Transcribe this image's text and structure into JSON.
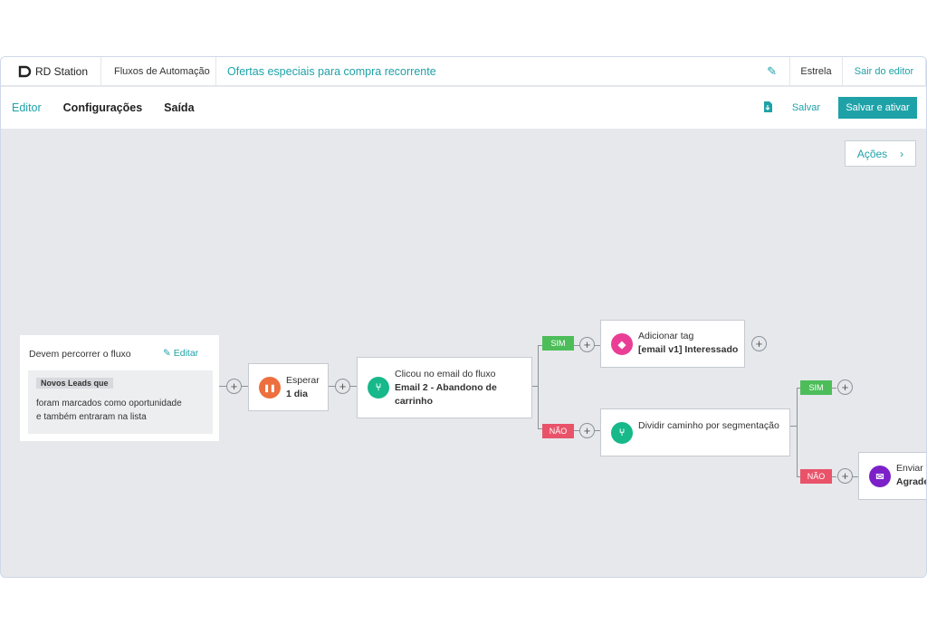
{
  "topbar": {
    "logo": "RD Station",
    "breadcrumb": "Fluxos de Automação",
    "flow_title": "Ofertas especiais para compra recorrente",
    "user": "Estrela",
    "exit": "Sair do editor"
  },
  "tabs": [
    "Editor",
    "Configurações",
    "Saída"
  ],
  "toolbar": {
    "save": "Salvar",
    "save_activate": "Salvar e ativar"
  },
  "canvas": {
    "actions": "Ações",
    "entry": {
      "heading": "Devem percorrer o fluxo",
      "edit": "Editar",
      "tag": "Novos Leads que",
      "line1": "foram marcados como oportunidade",
      "line2": "e também entraram na lista"
    },
    "wait": {
      "title": "Esperar",
      "value": "1 dia"
    },
    "click": {
      "title": "Clicou no email do fluxo",
      "line1": "Email 2 - Abandono de",
      "line2": "carrinho"
    },
    "yes_label": "SIM",
    "no_label": "NÃO",
    "add_tag": {
      "title": "Adicionar tag",
      "value": "[email v1] Interessado"
    },
    "split": {
      "title": "Dividir caminho por segmentação"
    },
    "send": {
      "title": "Enviar",
      "value": "Agrade"
    },
    "zoom_out": "−",
    "zoom_in": "+"
  },
  "colors": {
    "accent": "#1ea2a8",
    "wait": "#ec6f3d",
    "branch": "#17b889",
    "tag": "#ea3e96",
    "email": "#7c21c9",
    "yes": "#4dbd5a",
    "no": "#e9536a"
  },
  "icons": {
    "logo": "rd-logo-icon",
    "edit": "pencil-icon",
    "download": "download-icon",
    "wait": "pause-icon",
    "branch": "branch-icon",
    "tag": "tag-icon",
    "email": "envelope-icon"
  }
}
